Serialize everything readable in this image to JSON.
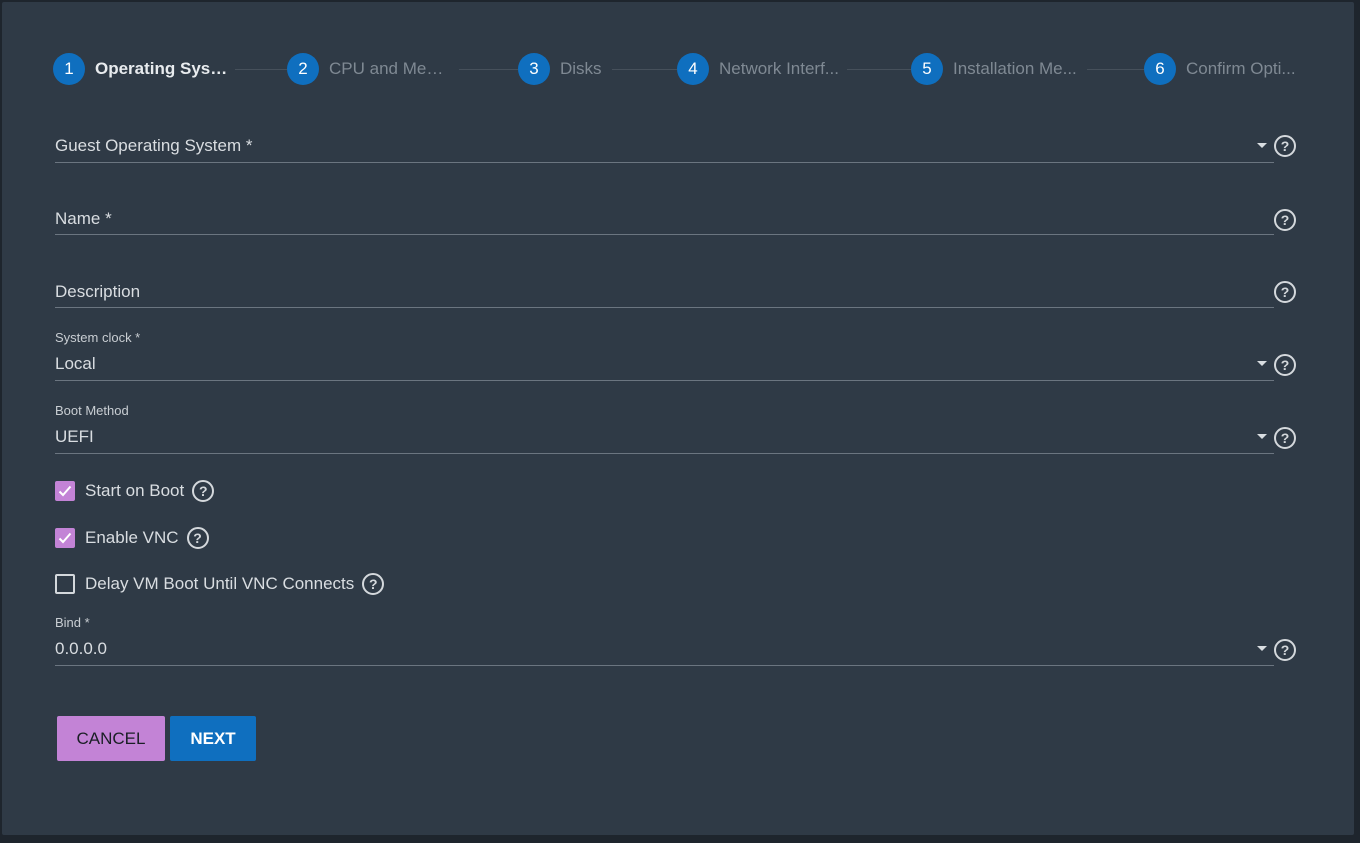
{
  "stepper": {
    "steps": [
      {
        "number": "1",
        "label": "Operating Syst..."
      },
      {
        "number": "2",
        "label": "CPU and Mem..."
      },
      {
        "number": "3",
        "label": "Disks"
      },
      {
        "number": "4",
        "label": "Network Interf..."
      },
      {
        "number": "5",
        "label": "Installation Me..."
      },
      {
        "number": "6",
        "label": "Confirm Opti..."
      }
    ],
    "active_step": 1
  },
  "form": {
    "guest_os": {
      "label": "Guest Operating System *",
      "value": ""
    },
    "name": {
      "label": "Name *",
      "value": ""
    },
    "description": {
      "label": "Description",
      "value": ""
    },
    "system_clock": {
      "label": "System clock *",
      "value": "Local"
    },
    "boot_method": {
      "label": "Boot Method",
      "value": "UEFI"
    },
    "start_on_boot": {
      "label": "Start on Boot",
      "checked": true
    },
    "enable_vnc": {
      "label": "Enable VNC",
      "checked": true
    },
    "delay_vm_boot": {
      "label": "Delay VM Boot Until VNC Connects",
      "checked": false
    },
    "bind": {
      "label": "Bind *",
      "value": "0.0.0.0"
    },
    "help_glyph": "?"
  },
  "actions": {
    "cancel_label": "CANCEL",
    "next_label": "NEXT"
  },
  "colors": {
    "background": "#2f3a46",
    "primary": "#0f6fbf",
    "accent": "#c383d6"
  }
}
